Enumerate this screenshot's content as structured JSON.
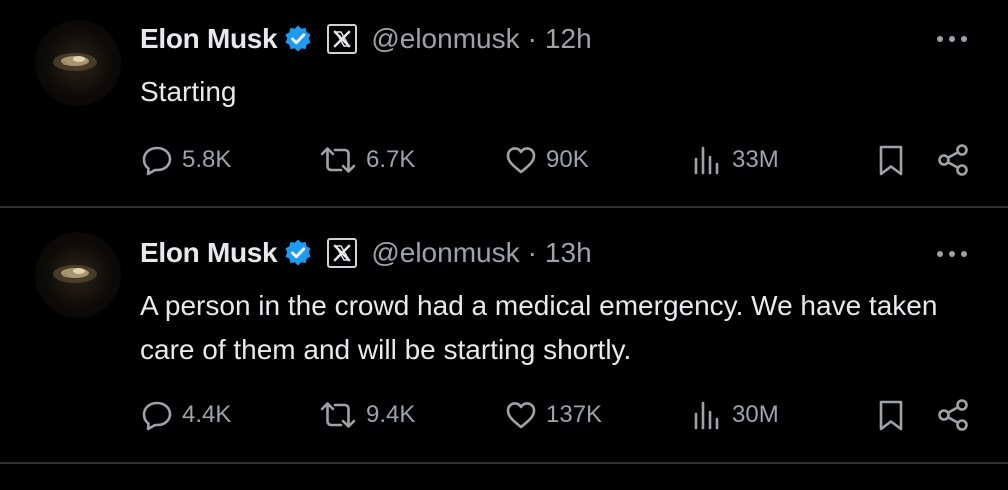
{
  "tweets": [
    {
      "author_name": "Elon Musk",
      "handle": "@elonmusk",
      "separator": "·",
      "time": "12h",
      "text": "Starting",
      "replies": "5.8K",
      "reposts": "6.7K",
      "likes": "90K",
      "views": "33M"
    },
    {
      "author_name": "Elon Musk",
      "handle": "@elonmusk",
      "separator": "·",
      "time": "13h",
      "text": "A person in the crowd had a medical emergency. We have taken care of them and will be starting shortly.",
      "replies": "4.4K",
      "reposts": "9.4K",
      "likes": "137K",
      "views": "30M"
    }
  ],
  "icons": {
    "verified": "verified-badge-icon",
    "affiliate": "x-logo-icon",
    "more": "more-dots-icon",
    "reply": "reply-bubble-icon",
    "repost": "repost-arrows-icon",
    "like": "heart-icon",
    "views": "views-bars-icon",
    "bookmark": "bookmark-icon",
    "share": "share-nodes-icon"
  },
  "colors": {
    "background": "#000000",
    "text": "#e7e9ea",
    "muted": "#9ea3a8",
    "verified": "#1d9bf0",
    "divider": "#2f3336"
  }
}
